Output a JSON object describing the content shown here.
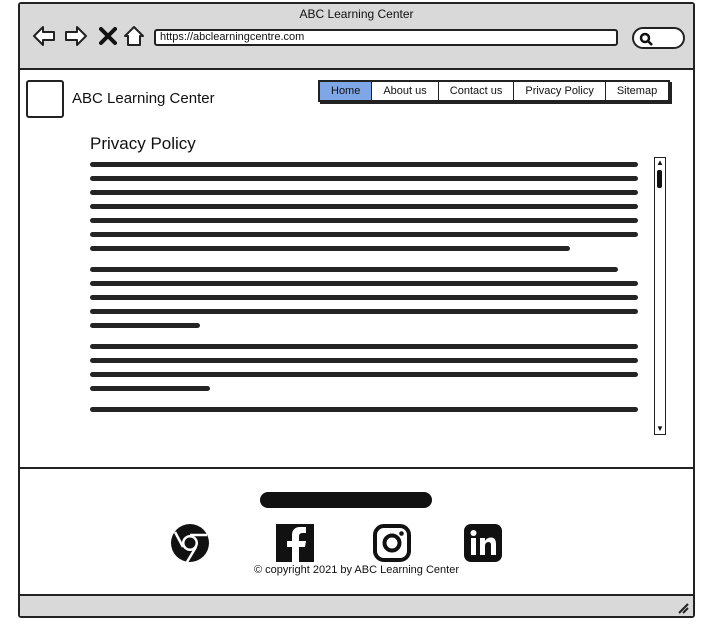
{
  "browser": {
    "window_title": "ABC Learning Center",
    "url": "https://abclearningcentre.com",
    "icons": [
      "back-arrow-icon",
      "forward-arrow-icon",
      "close-icon",
      "home-icon",
      "search-icon"
    ]
  },
  "site": {
    "name": "ABC Learning Center",
    "nav": [
      {
        "label": "Home",
        "active": true
      },
      {
        "label": "About us",
        "active": false
      },
      {
        "label": "Contact us",
        "active": false
      },
      {
        "label": "Privacy Policy",
        "active": false
      },
      {
        "label": "Sitemap",
        "active": false
      }
    ]
  },
  "main": {
    "title": "Privacy Policy"
  },
  "footer": {
    "social_icons": [
      "chrome-icon",
      "facebook-icon",
      "instagram-icon",
      "linkedin-icon"
    ],
    "copyright": "© copyright 2021 by ABC Learning Center"
  }
}
